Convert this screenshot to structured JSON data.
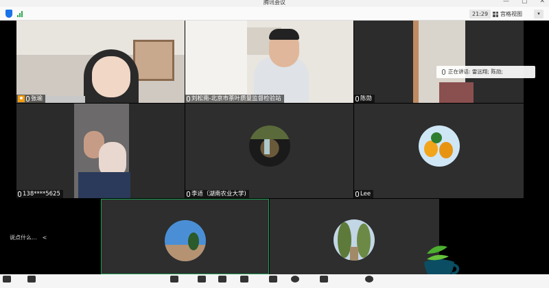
{
  "window": {
    "title": "腾讯会议",
    "controls": [
      "—",
      "▢",
      "✕"
    ]
  },
  "toolbar": {
    "timer": "21:29",
    "view_label": "宫格视图",
    "more_label": "▾"
  },
  "speaking_now": {
    "label": "正在讲话: 雷远翔; 陈勋;"
  },
  "participants": [
    {
      "name": "张瑜"
    },
    {
      "name": "刘松南-北京市茶叶质量监督检验站"
    },
    {
      "name": "陈勋"
    },
    {
      "name": "138****5625"
    },
    {
      "name": "李适（湖南农业大学)"
    },
    {
      "name": "Lee"
    }
  ],
  "chat": {
    "placeholder": "说点什么...",
    "collapse": "<"
  },
  "colors": {
    "active_border": "#1f9d55",
    "tile_bg": "#262626",
    "name_tag_bg": "rgba(0,0,0,0.55)"
  }
}
